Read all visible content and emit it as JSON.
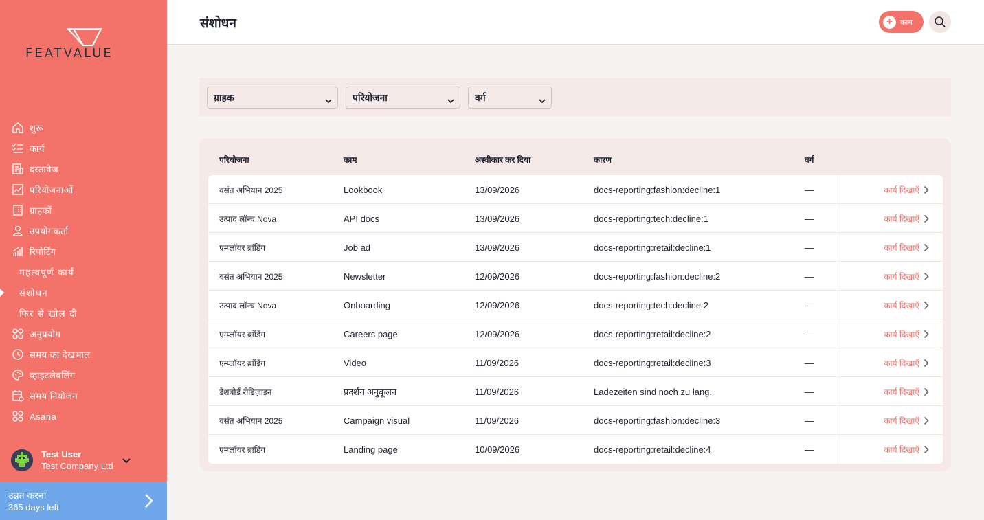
{
  "app": {
    "brand": "FEATVALUE",
    "colors": {
      "accent": "#f3736b",
      "upgrade": "#6fa8ea",
      "text": "#1f2330"
    }
  },
  "sidebar": {
    "items": [
      {
        "label": "शुरू",
        "icon": "home-icon"
      },
      {
        "label": "कार्य",
        "icon": "checklist-icon"
      },
      {
        "label": "दस्तावेज",
        "icon": "document-icon"
      },
      {
        "label": "परियोजनाओं",
        "icon": "chart-icon"
      },
      {
        "label": "ग्राहकों",
        "icon": "building-icon"
      },
      {
        "label": "उपयोगकर्ता",
        "icon": "user-icon"
      },
      {
        "label": "रिपोर्टिंग",
        "icon": "bar-chart-icon"
      }
    ],
    "sub_items": [
      {
        "label": "महत्वपूर्ण कार्य"
      },
      {
        "label": "संशोधन",
        "active": true
      },
      {
        "label": "फिर से खोल दी"
      }
    ],
    "items_after": [
      {
        "label": "अनुप्रयोग",
        "icon": "apps-icon"
      },
      {
        "label": "समय का देखभाल",
        "icon": "timer-icon"
      },
      {
        "label": "व्हाइटलेबलिंग",
        "icon": "palette-icon"
      },
      {
        "label": "समय नियोजन",
        "icon": "calendar-icon"
      },
      {
        "label": "Asana",
        "icon": "apps-icon"
      }
    ],
    "user": {
      "name": "Test User",
      "company": "Test Company Ltd"
    },
    "upgrade": {
      "title": "उन्नत करना",
      "subtitle": "365 days left"
    }
  },
  "header": {
    "title": "संशोधन",
    "add_label": "काम"
  },
  "filters": {
    "client": "ग्राहक",
    "project": "परियोजना",
    "category": "वर्ग"
  },
  "table": {
    "columns": [
      "परियोजना",
      "काम",
      "अस्वीकार कर दिया",
      "कारण",
      "वर्ग"
    ],
    "action_label": "कार्य दिखाएँ",
    "rows": [
      {
        "project": "वसंत अभियान 2025",
        "task": "Lookbook",
        "date": "13/09/2026",
        "reason": "docs-reporting:fashion:decline:1",
        "category": "—"
      },
      {
        "project": "उत्पाद लॉन्च Nova",
        "task": "API docs",
        "date": "13/09/2026",
        "reason": "docs-reporting:tech:decline:1",
        "category": "—"
      },
      {
        "project": "एम्प्लॉयर ब्रांडिंग",
        "task": "Job ad",
        "date": "13/09/2026",
        "reason": "docs-reporting:retail:decline:1",
        "category": "—"
      },
      {
        "project": "वसंत अभियान 2025",
        "task": "Newsletter",
        "date": "12/09/2026",
        "reason": "docs-reporting:fashion:decline:2",
        "category": "—"
      },
      {
        "project": "उत्पाद लॉन्च Nova",
        "task": "Onboarding",
        "date": "12/09/2026",
        "reason": "docs-reporting:tech:decline:2",
        "category": "—"
      },
      {
        "project": "एम्प्लॉयर ब्रांडिंग",
        "task": "Careers page",
        "date": "12/09/2026",
        "reason": "docs-reporting:retail:decline:2",
        "category": "—"
      },
      {
        "project": "एम्प्लॉयर ब्रांडिंग",
        "task": "Video",
        "date": "11/09/2026",
        "reason": "docs-reporting:retail:decline:3",
        "category": "—"
      },
      {
        "project": "डैशबोर्ड रीडिज़ाइन",
        "task": "प्रदर्शन अनुकूलन",
        "date": "11/09/2026",
        "reason": "Ladezeiten sind noch zu lang.",
        "category": "—"
      },
      {
        "project": "वसंत अभियान 2025",
        "task": "Campaign visual",
        "date": "11/09/2026",
        "reason": "docs-reporting:fashion:decline:3",
        "category": "—"
      },
      {
        "project": "एम्प्लॉयर ब्रांडिंग",
        "task": "Landing page",
        "date": "10/09/2026",
        "reason": "docs-reporting:retail:decline:4",
        "category": "—"
      }
    ]
  }
}
